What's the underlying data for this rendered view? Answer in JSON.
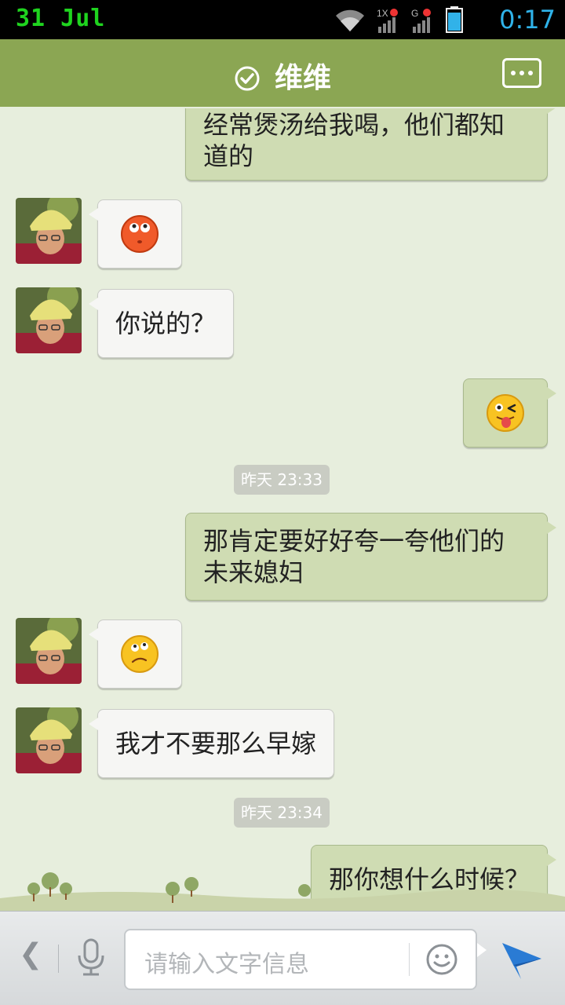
{
  "status_bar": {
    "date": "31  Jul",
    "time": "0:17",
    "icons": [
      "wifi-icon",
      "signal-1x-icon",
      "signal-g-icon",
      "battery-icon"
    ]
  },
  "header": {
    "title": "维维",
    "verified_icon": "check-circle-icon",
    "more_icon": "more-dots-icon",
    "color": "#8ba653"
  },
  "messages": [
    {
      "side": "out",
      "text": "经常煲汤给我喝，他们都知\n道的"
    },
    {
      "side": "in",
      "type": "emoji",
      "emoji": "rolling-eyes-face"
    },
    {
      "side": "in",
      "text": "你说的？"
    },
    {
      "side": "out",
      "type": "emoji",
      "emoji": "wink-tongue-face"
    },
    {
      "type": "timestamp",
      "text": "昨天 23:33"
    },
    {
      "side": "out",
      "text": "那肯定要好好夸一夸他们的\n未来媳妇"
    },
    {
      "side": "in",
      "type": "emoji",
      "emoji": "confused-face"
    },
    {
      "side": "in",
      "text": "我才不要那么早嫁"
    },
    {
      "type": "timestamp",
      "text": "昨天 23:34"
    },
    {
      "side": "out",
      "text": "那你想什么时候？"
    }
  ],
  "input_bar": {
    "placeholder": "请输入文字信息",
    "back_icon": "chevron-left-icon",
    "mic_icon": "microphone-icon",
    "emoji_icon": "smiley-icon",
    "send_icon": "send-icon"
  },
  "colors": {
    "background": "#e7eedd",
    "incoming_bubble": "#f6f6f4",
    "outgoing_bubble": "#cfdcb3",
    "timestamp_bg": "#c9ccc3",
    "send_icon": "#2a7bd4"
  }
}
